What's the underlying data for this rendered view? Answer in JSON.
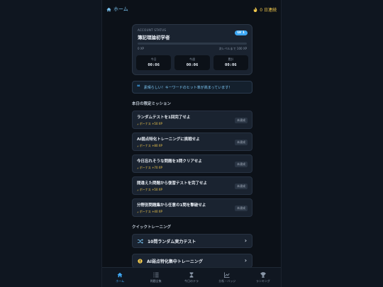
{
  "topbar": {
    "home_label": "ホーム",
    "streak_label": "0 日連続"
  },
  "status": {
    "label": "ACCOUNT STATUS",
    "title": "簿記理論初学者",
    "level": "LV 1",
    "xp": "0 XP",
    "next_level": "次レベルまで 100 XP",
    "progress_pct": 0,
    "timers": [
      {
        "label": "今日",
        "value": "00:06"
      },
      {
        "label": "今週",
        "value": "00:06"
      },
      {
        "label": "累計",
        "value": "00:06"
      }
    ]
  },
  "banner": {
    "text": "素晴らしい！キーワードのヒット率が高まっています！"
  },
  "missions": {
    "title": "本日の限定ミッション",
    "items": [
      {
        "title": "ランダムテストを1回完了せよ",
        "bonus": "ボーナス +50 XP",
        "state": "未達成"
      },
      {
        "title": "AI弱点特化トレーニングに挑戦せよ",
        "bonus": "ボーナス +80 XP",
        "state": "未達成"
      },
      {
        "title": "今日忘れそうな問題を3問クリアせよ",
        "bonus": "ボーナス +70 XP",
        "state": "未達成"
      },
      {
        "title": "間違えた問題から復習テストを完了せよ",
        "bonus": "ボーナス +50 XP",
        "state": "未達成"
      },
      {
        "title": "分野別問題集から任意の1問を撃破せよ",
        "bonus": "ボーナス +40 XP",
        "state": "未達成"
      }
    ]
  },
  "quick": {
    "title": "クイックトレーニング",
    "items": [
      {
        "label": "10問ランダム実力テスト"
      },
      {
        "label": "AI弱点特化集中トレーニング"
      }
    ]
  },
  "nav": {
    "items": [
      {
        "label": "ホーム"
      },
      {
        "label": "問題全集"
      },
      {
        "label": "今日のテラ"
      },
      {
        "label": "分析・バッジ"
      },
      {
        "label": "ランキング"
      }
    ]
  },
  "colors": {
    "accent": "#3fa9f5",
    "bonus": "#f2c94c",
    "card": "#1a2330",
    "background": "#0c1118"
  }
}
